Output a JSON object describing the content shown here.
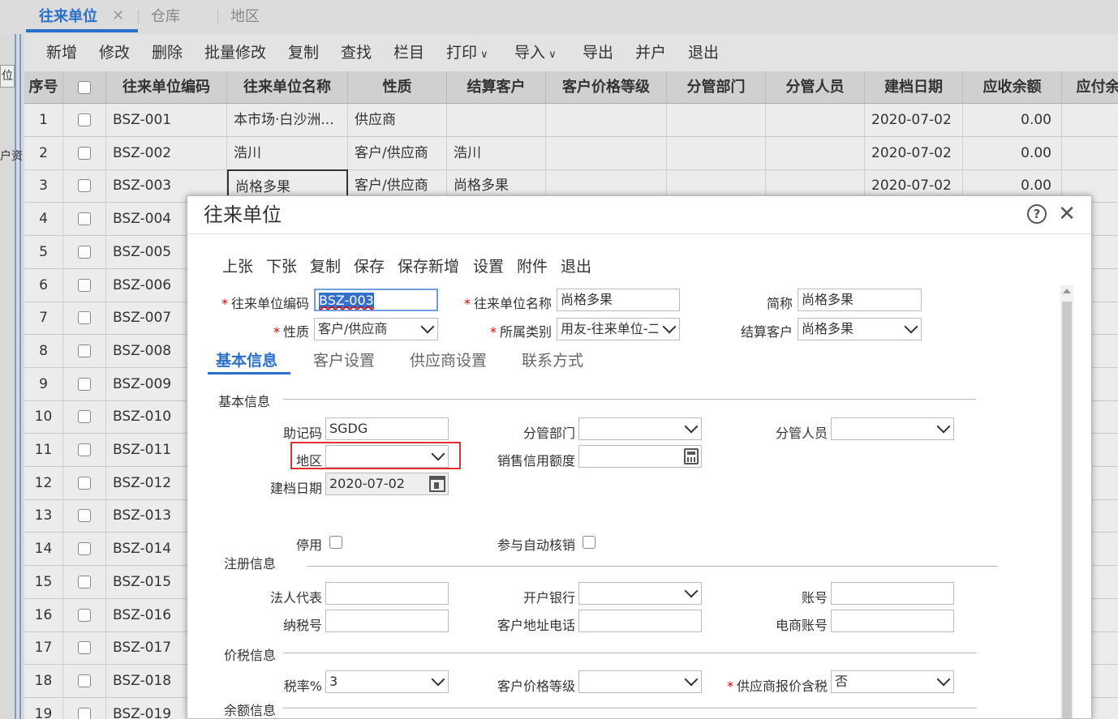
{
  "tabs": [
    {
      "label": "往来单位",
      "active": true,
      "closable": true
    },
    {
      "label": "仓库",
      "active": false
    },
    {
      "label": "地区",
      "active": false
    }
  ],
  "left": {
    "button_label": "位",
    "partial_text": "户资"
  },
  "toolbar": [
    "新增",
    "修改",
    "删除",
    "批量修改",
    "复制",
    "查找",
    "栏目",
    "打印",
    "导入",
    "导出",
    "并户",
    "退出"
  ],
  "grid": {
    "columns": [
      "序号",
      "",
      "往来单位编码",
      "往来单位名称",
      "性质",
      "结算客户",
      "客户价格等级",
      "分管部门",
      "分管人员",
      "建档日期",
      "应收余额",
      "应付余"
    ],
    "rows": [
      {
        "no": "1",
        "code": "BSZ-001",
        "name": "本市场·白沙洲...",
        "type": "供应商",
        "settle": "",
        "date": "2020-07-02",
        "ar": "0.00"
      },
      {
        "no": "2",
        "code": "BSZ-002",
        "name": "浩川",
        "type": "客户/供应商",
        "settle": "浩川",
        "date": "2020-07-02",
        "ar": "0.00"
      },
      {
        "no": "3",
        "code": "BSZ-003",
        "name": "尚格多果",
        "type": "客户/供应商",
        "settle": "尚格多果",
        "date": "2020-07-02",
        "ar": "0.00"
      },
      {
        "no": "4",
        "code": "BSZ-004"
      },
      {
        "no": "5",
        "code": "BSZ-005"
      },
      {
        "no": "6",
        "code": "BSZ-006"
      },
      {
        "no": "7",
        "code": "BSZ-007"
      },
      {
        "no": "8",
        "code": "BSZ-008"
      },
      {
        "no": "9",
        "code": "BSZ-009"
      },
      {
        "no": "10",
        "code": "BSZ-010"
      },
      {
        "no": "11",
        "code": "BSZ-011"
      },
      {
        "no": "12",
        "code": "BSZ-012"
      },
      {
        "no": "13",
        "code": "BSZ-013"
      },
      {
        "no": "14",
        "code": "BSZ-014"
      },
      {
        "no": "15",
        "code": "BSZ-015"
      },
      {
        "no": "16",
        "code": "BSZ-016"
      },
      {
        "no": "17",
        "code": "BSZ-017"
      },
      {
        "no": "18",
        "code": "BSZ-018"
      },
      {
        "no": "19",
        "code": "BSZ-019"
      }
    ]
  },
  "modal": {
    "title": "往来单位",
    "toolbar": [
      "上张",
      "下张",
      "复制",
      "保存",
      "保存新增",
      "设置",
      "附件",
      "退出"
    ],
    "code_label": "往来单位编码",
    "code_value": "BSZ-003",
    "name_label": "往来单位名称",
    "name_value": "尚格多果",
    "short_label": "简称",
    "short_value": "尚格多果",
    "type_label": "性质",
    "type_value": "客户/供应商",
    "category_label": "所属类别",
    "category_value": "用友-往来单位-二",
    "settle_label": "结算客户",
    "settle_value": "尚格多果",
    "tabs": [
      "基本信息",
      "客户设置",
      "供应商设置",
      "联系方式"
    ],
    "section_basic": "基本信息",
    "mnemonic_label": "助记码",
    "mnemonic_value": "SGDG",
    "dept_label": "分管部门",
    "dept_value": "",
    "staff_label": "分管人员",
    "staff_value": "",
    "region_label": "地区",
    "region_value": "",
    "credit_label": "销售信用额度",
    "credit_value": "",
    "date_label": "建档日期",
    "date_value": "2020-07-02",
    "disabled_label": "停用",
    "autoverify_label": "参与自动核销",
    "section_reg": "注册信息",
    "legal_label": "法人代表",
    "legal_value": "",
    "bank_label": "开户银行",
    "bank_value": "",
    "account_label": "账号",
    "account_value": "",
    "taxno_label": "纳税号",
    "taxno_value": "",
    "addr_label": "客户地址电话",
    "addr_value": "",
    "ecom_label": "电商账号",
    "ecom_value": "",
    "section_price": "价税信息",
    "taxrate_label": "税率%",
    "taxrate_value": "3",
    "pricelevel_label": "客户价格等级",
    "pricelevel_value": "",
    "quote_tax_label": "供应商报价含税",
    "quote_tax_value": "否",
    "section_balance": "余额信息"
  }
}
